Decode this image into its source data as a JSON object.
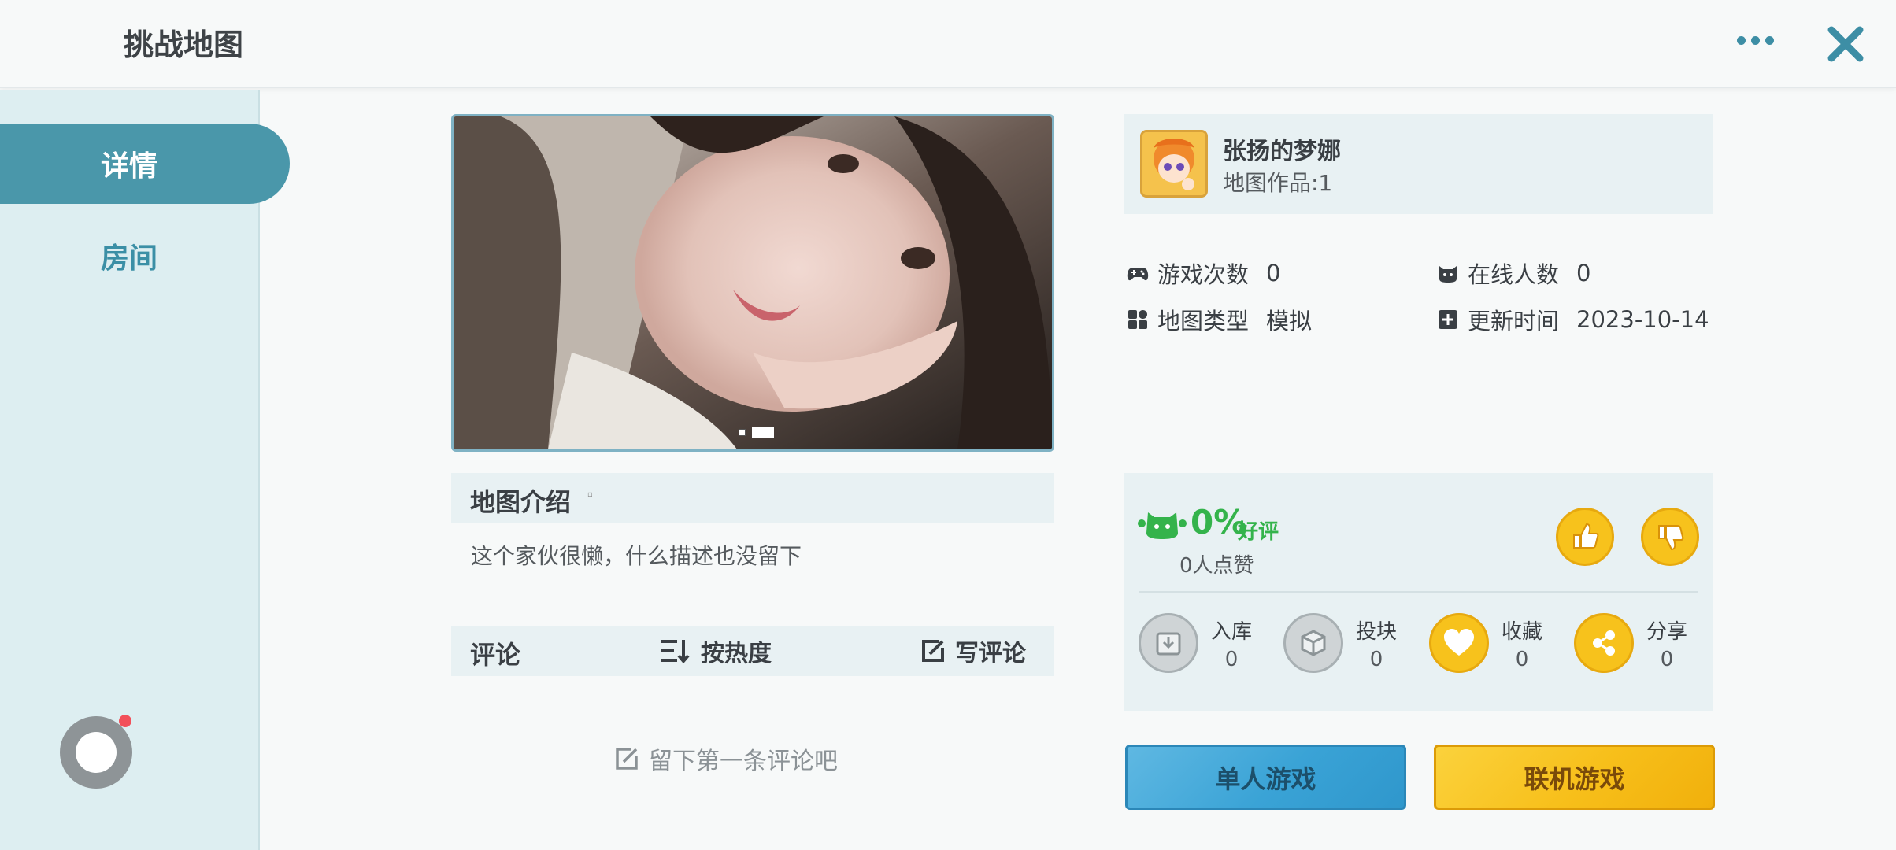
{
  "header": {
    "title": "挑战地图",
    "more_icon": "more-dots-icon",
    "close_icon": "close-icon",
    "accent": "#3d8ea5"
  },
  "sidebar": {
    "tabs": [
      {
        "label": "详情",
        "active": true
      },
      {
        "label": "房间",
        "active": false
      }
    ],
    "float_button_icon": "record-icon"
  },
  "preview": {
    "slide_count": 2,
    "active_slide": 2
  },
  "intro": {
    "title": "地图介绍",
    "text": "这个家伙很懒，什么描述也没留下"
  },
  "comments": {
    "title": "评论",
    "sort_label": "按热度",
    "write_label": "写评论",
    "empty_label": "留下第一条评论吧"
  },
  "author": {
    "name": "张扬的梦娜",
    "works": "地图作品:1"
  },
  "stats": {
    "plays_label": "游戏次数",
    "plays_value": "0",
    "online_label": "在线人数",
    "online_value": "0",
    "type_label": "地图类型",
    "type_value": "模拟",
    "updated_label": "更新时间",
    "updated_value": "2023-10-14"
  },
  "rating": {
    "percent": "0%",
    "good_label": "好评",
    "likes_text": "0人点赞",
    "color": "#34b34b"
  },
  "actions": [
    {
      "label": "入库",
      "count": "0",
      "icon": "download-box-icon"
    },
    {
      "label": "投块",
      "count": "0",
      "icon": "cube-icon"
    },
    {
      "label": "收藏",
      "count": "0",
      "icon": "heart-icon"
    },
    {
      "label": "分享",
      "count": "0",
      "icon": "share-icon"
    }
  ],
  "buttons": {
    "single": "单人游戏",
    "multi": "联机游戏"
  }
}
